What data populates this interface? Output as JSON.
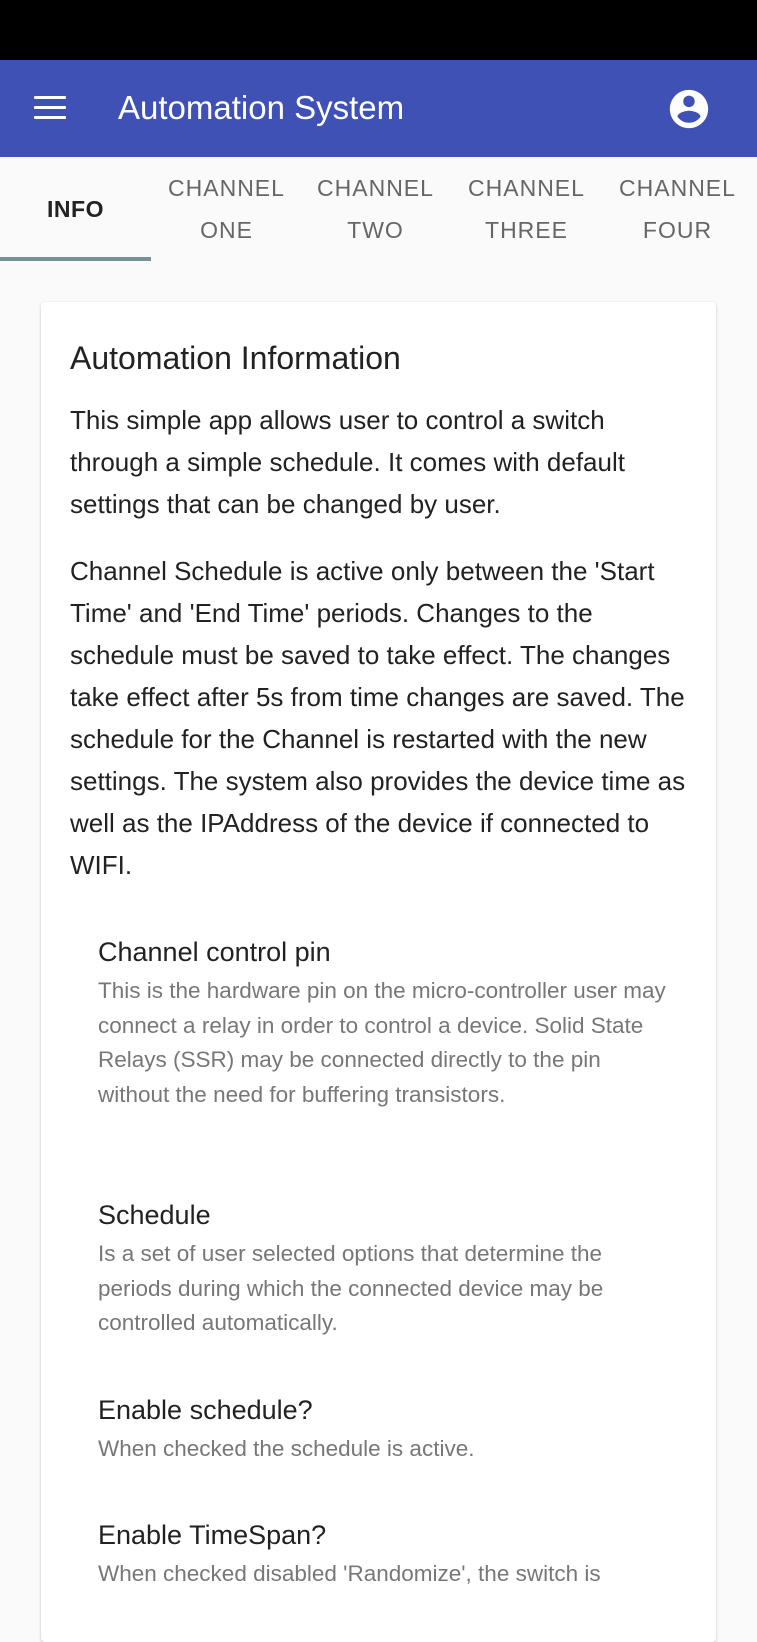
{
  "app": {
    "title": "Automation System"
  },
  "tabs": [
    {
      "label": "INFO",
      "selected": true
    },
    {
      "label": "CHANNEL ONE",
      "selected": false
    },
    {
      "label": "CHANNEL TWO",
      "selected": false
    },
    {
      "label": "CHANNEL THREE",
      "selected": false
    },
    {
      "label": "CHANNEL FOUR",
      "selected": false
    }
  ],
  "info": {
    "title": "Automation Information",
    "paragraphs": [
      "This simple app allows user to control a switch through a simple schedule. It comes with default settings that can be changed by user.",
      "Channel Schedule is active only between the 'Start Time' and 'End Time' periods. Changes to the schedule must be saved to take effect. The changes take effect after 5s from time changes are saved. The schedule for the Channel is restarted with the new settings. The system also provides the device time as well as the IPAddress of the device if connected to WIFI."
    ],
    "items": [
      {
        "title": "Channel control pin",
        "description": "This is the hardware pin on the micro-controller user may connect a relay in order to control a device. Solid State Relays (SSR) may be connected directly to the pin without the need for buffering transistors."
      },
      {
        "title": "Schedule",
        "description": "Is a set of user selected options that determine the periods during which the connected device may be controlled automatically."
      },
      {
        "title": "Enable schedule?",
        "description": "When checked the schedule is active."
      },
      {
        "title": "Enable TimeSpan?",
        "description": "When checked disabled 'Randomize', the switch is"
      }
    ]
  },
  "colors": {
    "primary": "#3f51b5",
    "tab_indicator": "#78909c",
    "status_bar": "#000000"
  },
  "icons": {
    "menu": "menu-icon",
    "account": "account-circle-icon"
  }
}
